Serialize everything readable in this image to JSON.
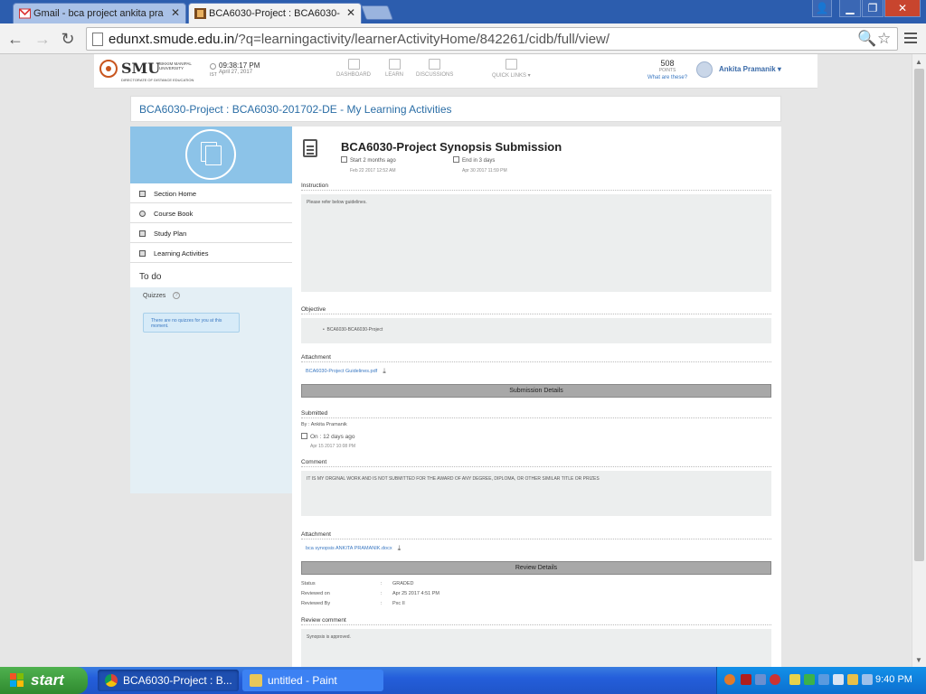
{
  "browser": {
    "tabs": [
      {
        "title": "Gmail - bca project ankita pra",
        "active": false
      },
      {
        "title": "BCA6030-Project : BCA6030-",
        "active": true
      }
    ],
    "url_host": "edunxt.smude.edu.in",
    "url_path": "/?q=learningactivity/learnerActivityHome/842261/cidb/full/view/"
  },
  "header": {
    "logo_text": "SMU",
    "logo_university": "SIKKIM MANIPAL UNIVERSITY",
    "logo_directorate": "DIRECTORATE OF DISTANCE EDUCATION",
    "time": "09:38:17 PM",
    "timezone": "IST",
    "date": "April 27, 2017",
    "nav": [
      "DASHBOARD",
      "LEARN",
      "DISCUSSIONS",
      "QUICK LINKS"
    ],
    "points_value": "508",
    "points_label": "POINTS",
    "points_link": "What are these?",
    "user_name": "Ankita Pramanik"
  },
  "breadcrumb": "BCA6030-Project : BCA6030-201702-DE - My Learning Activities",
  "sidebar": {
    "items": [
      {
        "label": "Section Home"
      },
      {
        "label": "Course Book"
      },
      {
        "label": "Study Plan"
      },
      {
        "label": "Learning Activities"
      }
    ],
    "todo_title": "To do",
    "quizzes_label": "Quizzes",
    "quizzes_help": "?",
    "quizzes_note": "There are no quizzes for you at this moment."
  },
  "activity": {
    "title": "BCA6030-Project Synopsis Submission",
    "start_label": "Start 2 months ago",
    "start_date": "Feb 22 2017 12:52 AM",
    "end_label": "End in 3 days",
    "end_date": "Apr 30 2017 11:59 PM",
    "instruction_label": "Instruction",
    "instruction_text": "Please refer below guidelines.",
    "objective_label": "Objective",
    "objective_item": "BCA6030-BCA6030-Project",
    "attachment_label": "Attachment",
    "attachment_file": "BCA6030-Project Guidelines.pdf",
    "submission_bar": "Submission Details",
    "submitted_label": "Submitted",
    "submitted_by": "By : Ankita Pramanik",
    "submitted_on": "On : 12 days ago",
    "submitted_date": "Apr 15 2017 10:08 PM",
    "comment_label": "Comment",
    "comment_text": "IT IS MY ORGINAL WORK AND IS NOT SUBMITTED FOR THE AWARD OF ANY DEGREE, DIPLOMA, OR OTHER SIMILAR TITLE OR PRIZES",
    "attachment2_label": "Attachment",
    "attachment2_file": "bca synopsis ANKITA PRAMANIK.docx",
    "review_bar": "Review Details",
    "review_rows": [
      {
        "key": "Status",
        "value": "GRADED"
      },
      {
        "key": "Reviewed on",
        "value": "Apr 25 2017 4:51 PM"
      },
      {
        "key": "Reviewed By",
        "value": "Pxc II"
      }
    ],
    "review_comment_label": "Review comment",
    "review_comment_text": "Synopsis is approved."
  },
  "taskbar": {
    "start_label": "start",
    "tasks": [
      {
        "label": "BCA6030-Project : B..."
      },
      {
        "label": "untitled - Paint"
      }
    ],
    "clock": "9:40 PM"
  }
}
